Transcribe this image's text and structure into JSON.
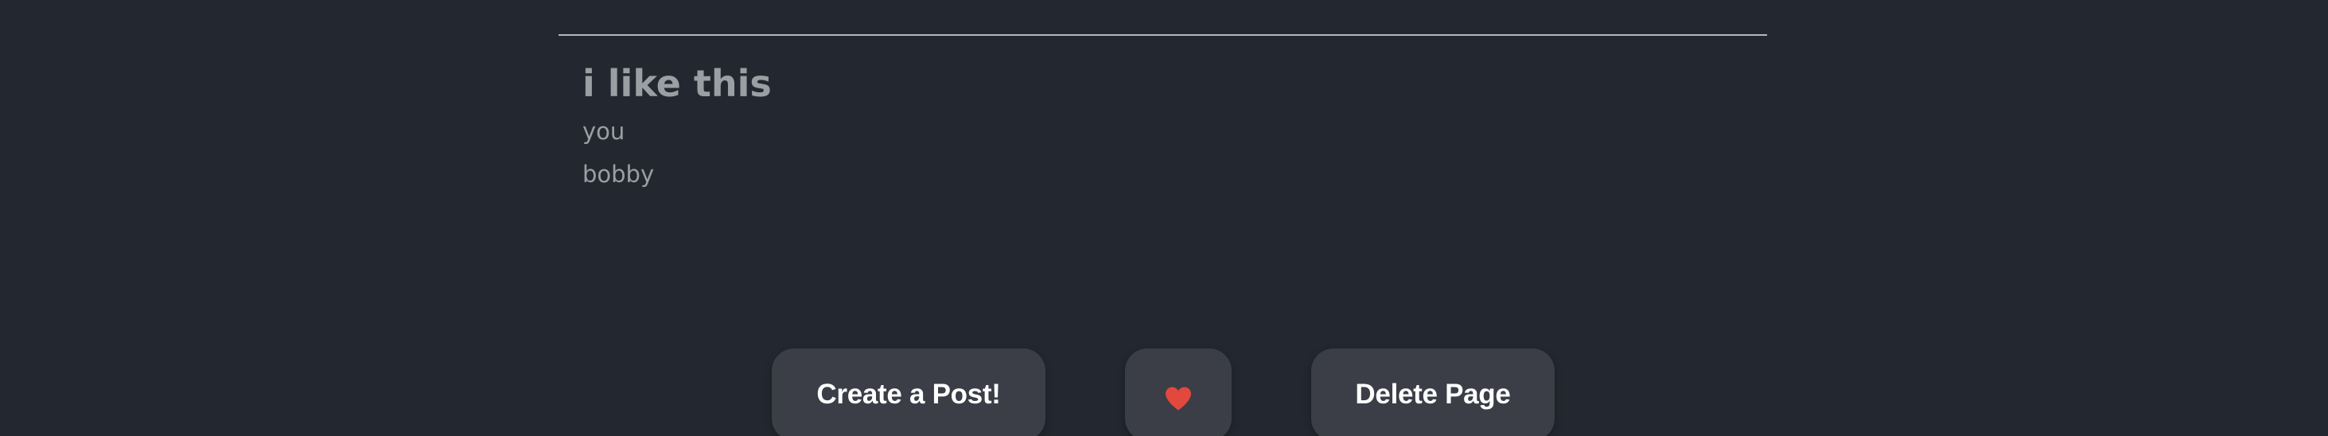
{
  "post": {
    "title": "i like this",
    "lines": [
      "you",
      "bobby"
    ]
  },
  "actions": {
    "create_label": "Create a Post!",
    "like_icon": "heart-icon",
    "delete_label": "Delete Page"
  },
  "colors": {
    "background": "#23272f",
    "button_bg": "#3b3e47",
    "heart": "#e2483d",
    "text_muted": "#9b9ea3"
  }
}
